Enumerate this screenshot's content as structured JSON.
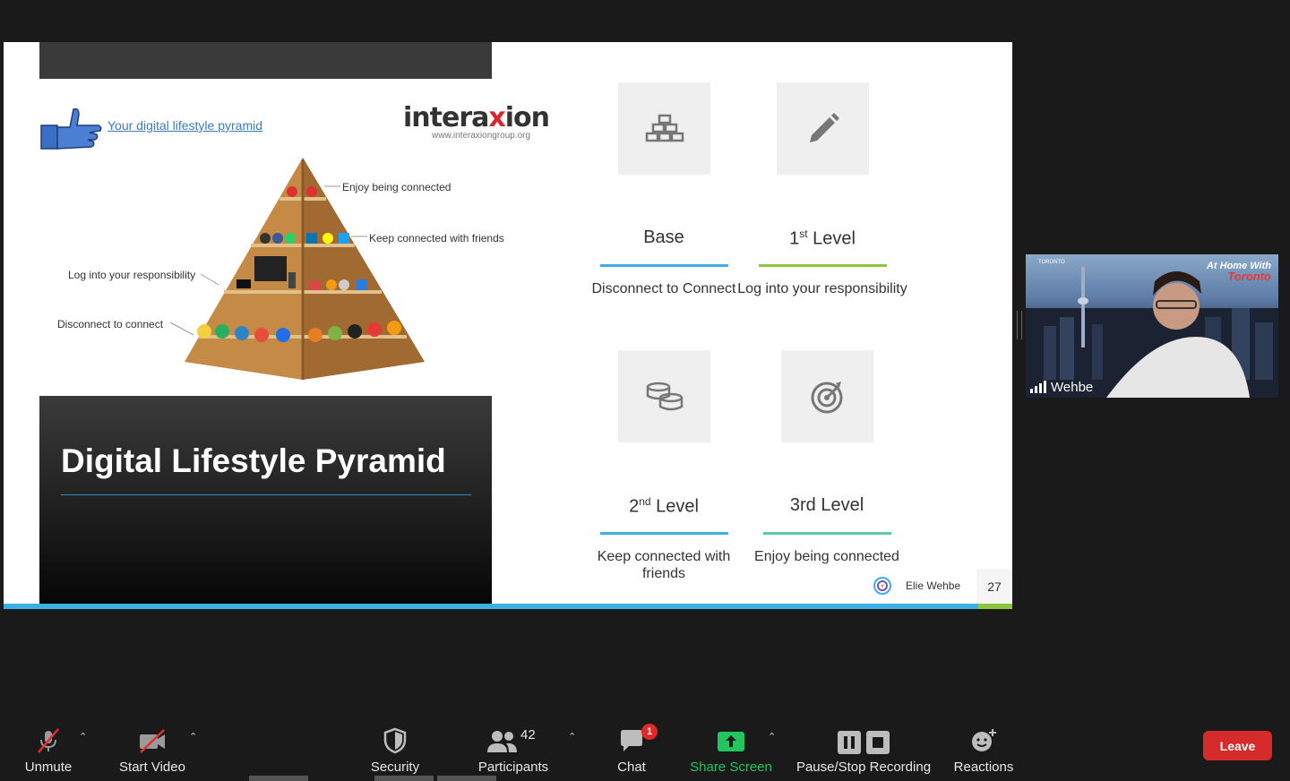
{
  "slide": {
    "pyramid_link": "Your digital lifestyle pyramid",
    "logo_text_pre": "intera",
    "logo_text_x": "x",
    "logo_text_post": "ion",
    "logo_url": "www.interaxiongroup.org",
    "pyramid_labels": {
      "enjoy": "Enjoy being connected",
      "keep": "Keep connected with friends",
      "log": "Log into your responsibility",
      "disconnect": "Disconnect to connect"
    },
    "dark_title": "Digital Lifestyle Pyramid",
    "levels": [
      {
        "title": "Base",
        "title_sup": "",
        "title_suffix": "",
        "desc": "Disconnect to Connect",
        "icon": "bricks-icon",
        "line_color": "#3db0e3"
      },
      {
        "title": "1",
        "title_sup": "st",
        "title_suffix": " Level",
        "desc": "Log into your responsibility",
        "icon": "pencil-icon",
        "line_color": "#8cc63f"
      },
      {
        "title": "2",
        "title_sup": "nd",
        "title_suffix": " Level",
        "desc": "Keep connected with friends",
        "icon": "coins-icon",
        "line_color": "#3db0e3"
      },
      {
        "title": "3rd Level",
        "title_sup": "",
        "title_suffix": "",
        "desc": "Enjoy being connected",
        "icon": "target-icon",
        "line_color": "#5cc9a7"
      }
    ],
    "footer_name": "Elie Wehbe",
    "page_number": "27"
  },
  "video": {
    "participant_name": "Wehbe",
    "brand_line1": "At Home With",
    "brand_line2": "Toronto",
    "city_tag": "TORONTO"
  },
  "toolbar": {
    "unmute": "Unmute",
    "start_video": "Start Video",
    "security": "Security",
    "participants": "Participants",
    "participants_count": "42",
    "chat": "Chat",
    "chat_badge": "1",
    "share_screen": "Share Screen",
    "recording": "Pause/Stop Recording",
    "reactions": "Reactions",
    "leave": "Leave"
  },
  "colors": {
    "share_green": "#22c55e",
    "leave_red": "#d52b2b",
    "accent_blue": "#3db0e3",
    "accent_green": "#8cc63f"
  }
}
